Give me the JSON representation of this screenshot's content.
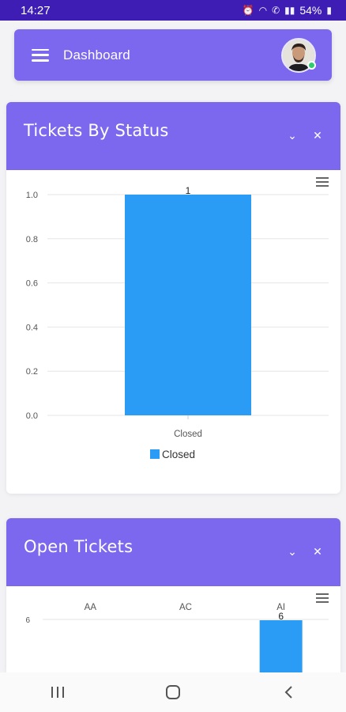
{
  "status_bar": {
    "time": "14:27",
    "battery": "54%"
  },
  "header": {
    "title": "Dashboard"
  },
  "cards": {
    "status": {
      "title": "Tickets By Status",
      "chart_data": {
        "type": "bar",
        "categories": [
          "Closed"
        ],
        "series": [
          {
            "name": "Closed",
            "values": [
              1
            ],
            "color": "#2b9cf5"
          }
        ],
        "data_labels": [
          "1"
        ],
        "ylim": [
          0,
          1
        ],
        "yticks": [
          "0.0",
          "0.2",
          "0.4",
          "0.6",
          "0.8",
          "1.0"
        ],
        "legend": {
          "label": "Closed",
          "placement": "bottom"
        },
        "grid": true
      }
    },
    "open": {
      "title": "Open Tickets",
      "chart_data": {
        "type": "bar",
        "categories": [
          "AA",
          "AC",
          "AI"
        ],
        "values": [
          null,
          null,
          6
        ],
        "data_labels": [
          "",
          "",
          "6"
        ],
        "ytick_visible": "6",
        "colors": {
          "bar": "#2b9cf5"
        }
      }
    }
  },
  "icons": {
    "menu": "hamburger-icon",
    "collapse": "chevron-down-icon",
    "close": "close-icon"
  }
}
